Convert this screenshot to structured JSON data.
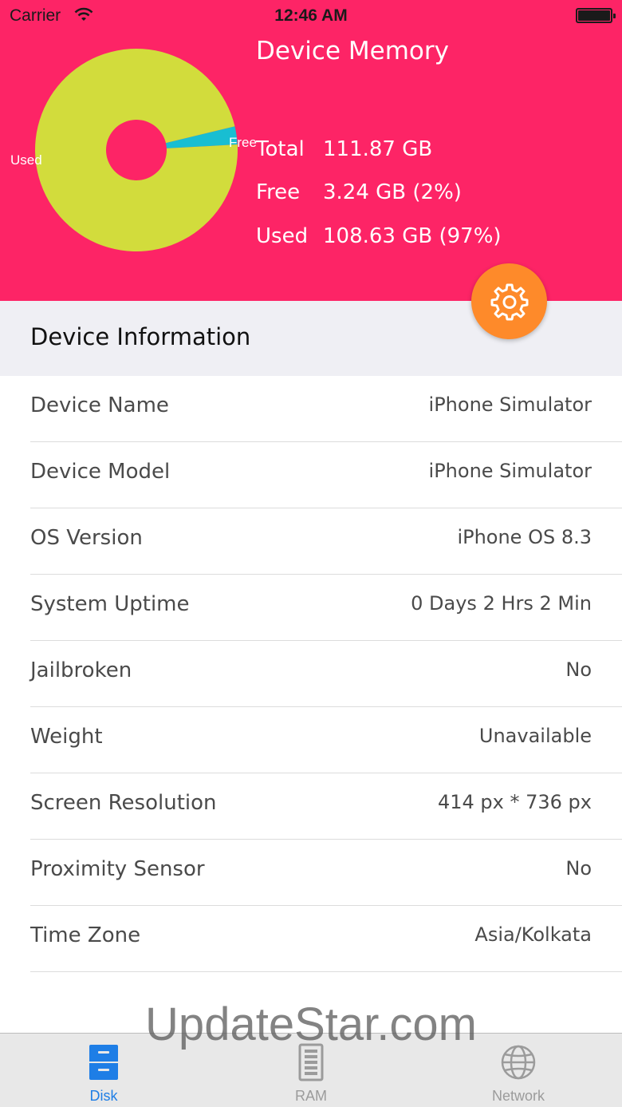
{
  "status_bar": {
    "carrier": "Carrier",
    "time": "12:46 AM",
    "wifi_icon": "wifi-icon",
    "battery_icon": "battery-icon"
  },
  "memory": {
    "title": "Device Memory",
    "stats": [
      {
        "key": "Total",
        "value": "111.87 GB"
      },
      {
        "key": "Free",
        "value": "3.24 GB (2%)"
      },
      {
        "key": "Used",
        "value": "108.63 GB (97%)"
      }
    ],
    "chart": {
      "type": "pie",
      "slices": [
        {
          "label": "Used",
          "value": 97.1,
          "color": "#d2dc3c"
        },
        {
          "label": "Free",
          "value": 2.9,
          "color": "#18bed2"
        }
      ]
    },
    "colors": {
      "header_bg": "#fd2466",
      "fab_bg": "#fe8a2a"
    }
  },
  "settings_button": {
    "icon": "gear-icon"
  },
  "section": {
    "title": "Device Information"
  },
  "info_rows": [
    {
      "label": "Device Name",
      "value": "iPhone Simulator"
    },
    {
      "label": "Device Model",
      "value": "iPhone Simulator"
    },
    {
      "label": "OS Version",
      "value": "iPhone OS 8.3"
    },
    {
      "label": "System Uptime",
      "value": "0 Days 2 Hrs 2 Min"
    },
    {
      "label": "Jailbroken",
      "value": "No"
    },
    {
      "label": "Weight",
      "value": "Unavailable"
    },
    {
      "label": "Screen Resolution",
      "value": "414 px * 736 px"
    },
    {
      "label": "Proximity Sensor",
      "value": "No"
    },
    {
      "label": "Time Zone",
      "value": "Asia/Kolkata"
    }
  ],
  "watermark": {
    "text": "UpdateStar.com"
  },
  "tabs": [
    {
      "label": "Disk",
      "icon": "disk-icon",
      "active": true
    },
    {
      "label": "RAM",
      "icon": "ram-icon",
      "active": false
    },
    {
      "label": "Network",
      "icon": "globe-icon",
      "active": false
    }
  ],
  "tab_colors": {
    "active": "#1e7ee6",
    "inactive": "#9b9b9b"
  }
}
